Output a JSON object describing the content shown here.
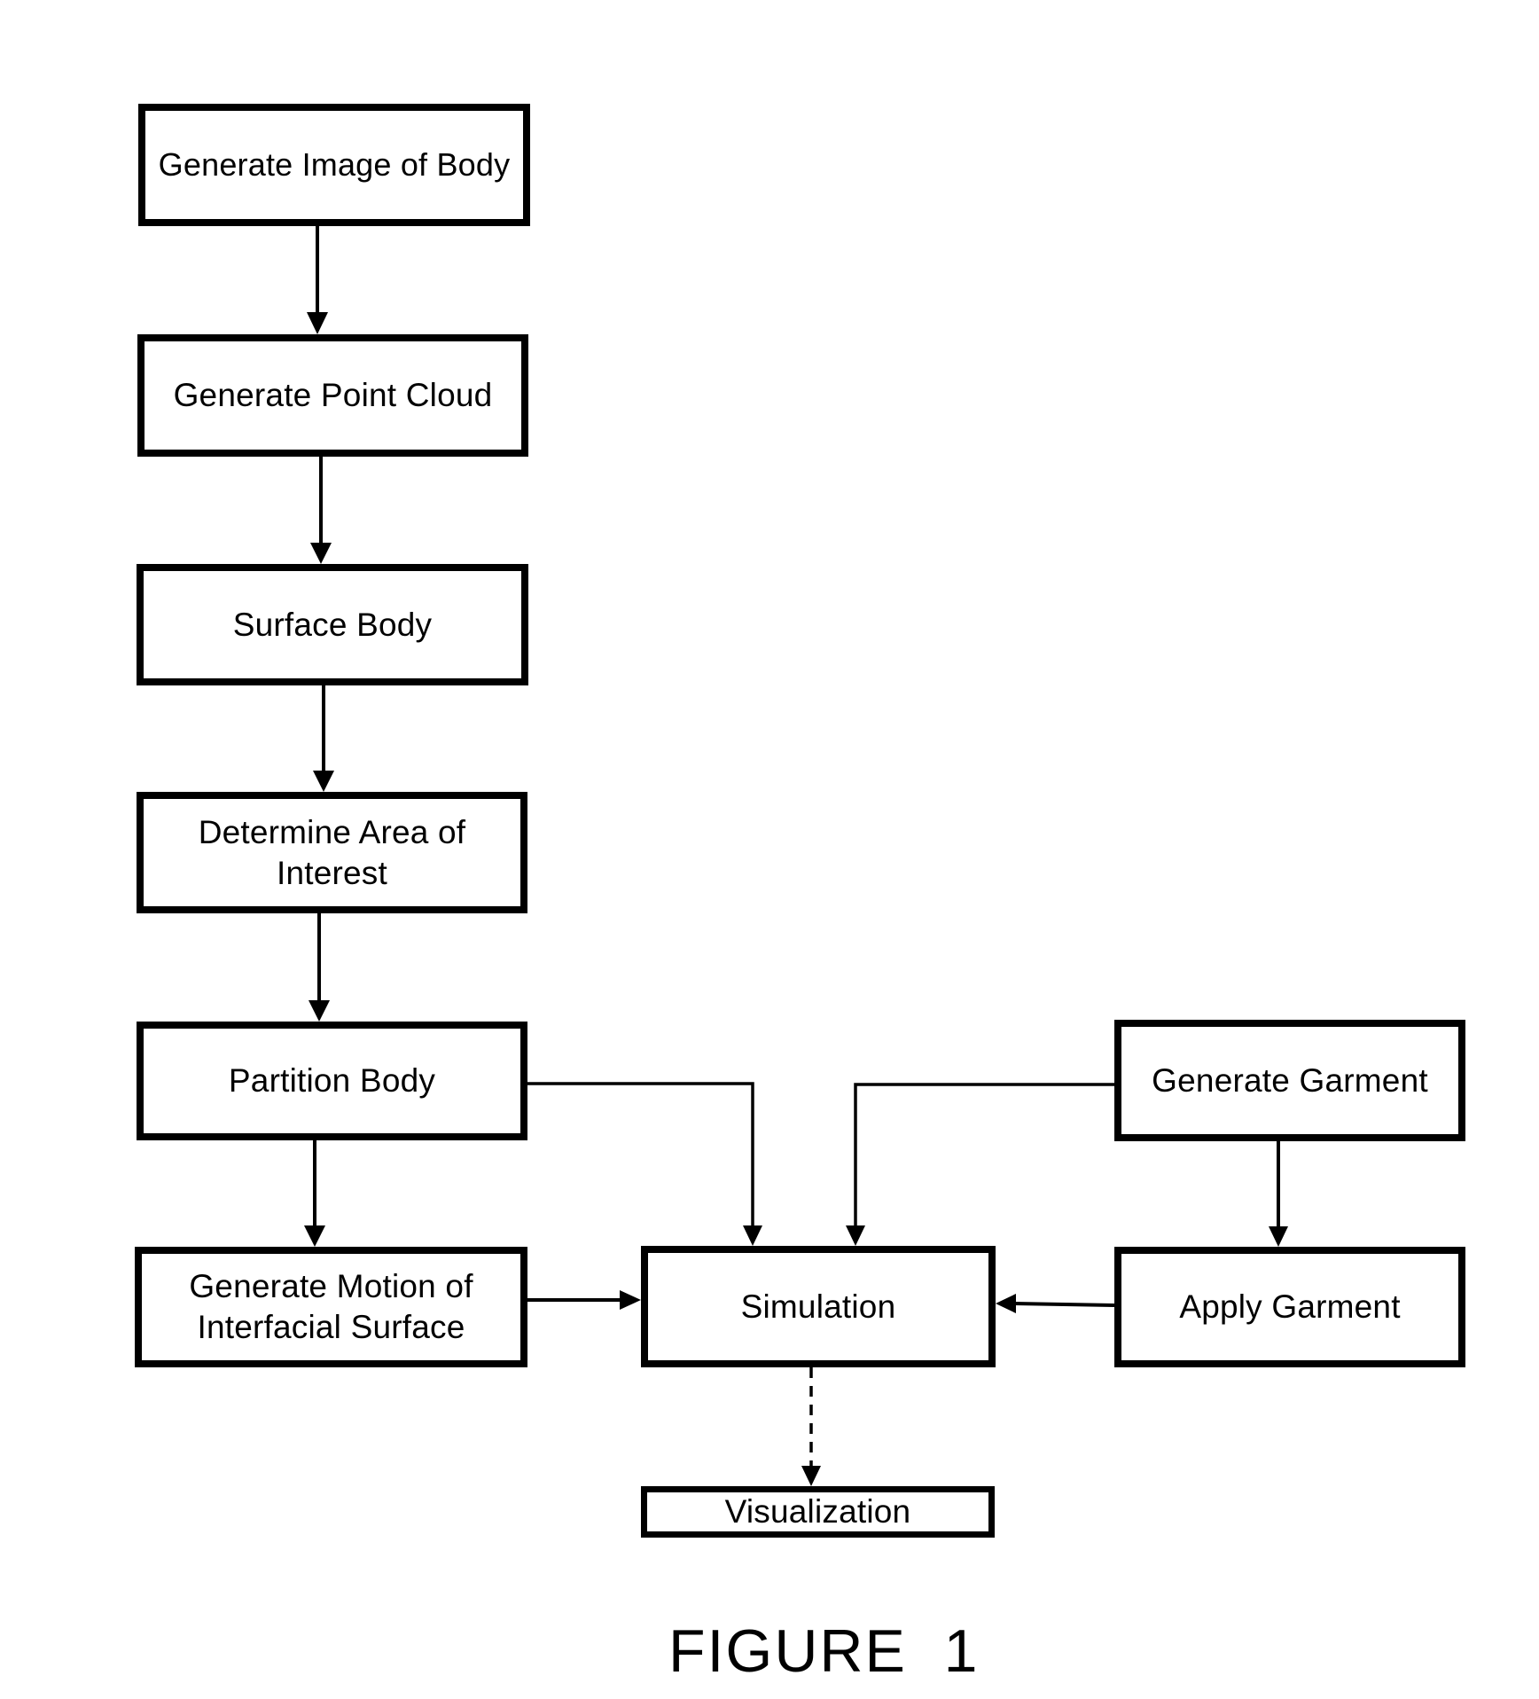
{
  "diagram": {
    "title": "FIGURE  1",
    "nodes": [
      {
        "id": "generate-image",
        "label": "Generate Image of Body"
      },
      {
        "id": "point-cloud",
        "label": "Generate Point Cloud"
      },
      {
        "id": "surface-body",
        "label": "Surface Body"
      },
      {
        "id": "area-of-interest",
        "label_lines": [
          "Determine Area of",
          "Interest"
        ]
      },
      {
        "id": "partition-body",
        "label": "Partition Body"
      },
      {
        "id": "motion-surface",
        "label_lines": [
          "Generate Motion of",
          "Interfacial Surface"
        ]
      },
      {
        "id": "simulation",
        "label": "Simulation"
      },
      {
        "id": "generate-garment",
        "label": "Generate Garment"
      },
      {
        "id": "apply-garment",
        "label": "Apply Garment"
      },
      {
        "id": "visualization",
        "label": "Visualization"
      }
    ],
    "edges": [
      {
        "from": "generate-image",
        "to": "point-cloud",
        "style": "solid"
      },
      {
        "from": "point-cloud",
        "to": "surface-body",
        "style": "solid"
      },
      {
        "from": "surface-body",
        "to": "area-of-interest",
        "style": "solid"
      },
      {
        "from": "area-of-interest",
        "to": "partition-body",
        "style": "solid"
      },
      {
        "from": "partition-body",
        "to": "motion-surface",
        "style": "solid"
      },
      {
        "from": "partition-body",
        "to": "simulation",
        "style": "solid"
      },
      {
        "from": "motion-surface",
        "to": "simulation",
        "style": "solid"
      },
      {
        "from": "generate-garment",
        "to": "simulation",
        "style": "solid"
      },
      {
        "from": "generate-garment",
        "to": "apply-garment",
        "style": "solid"
      },
      {
        "from": "apply-garment",
        "to": "simulation",
        "style": "solid"
      },
      {
        "from": "simulation",
        "to": "visualization",
        "style": "dashed"
      }
    ]
  }
}
